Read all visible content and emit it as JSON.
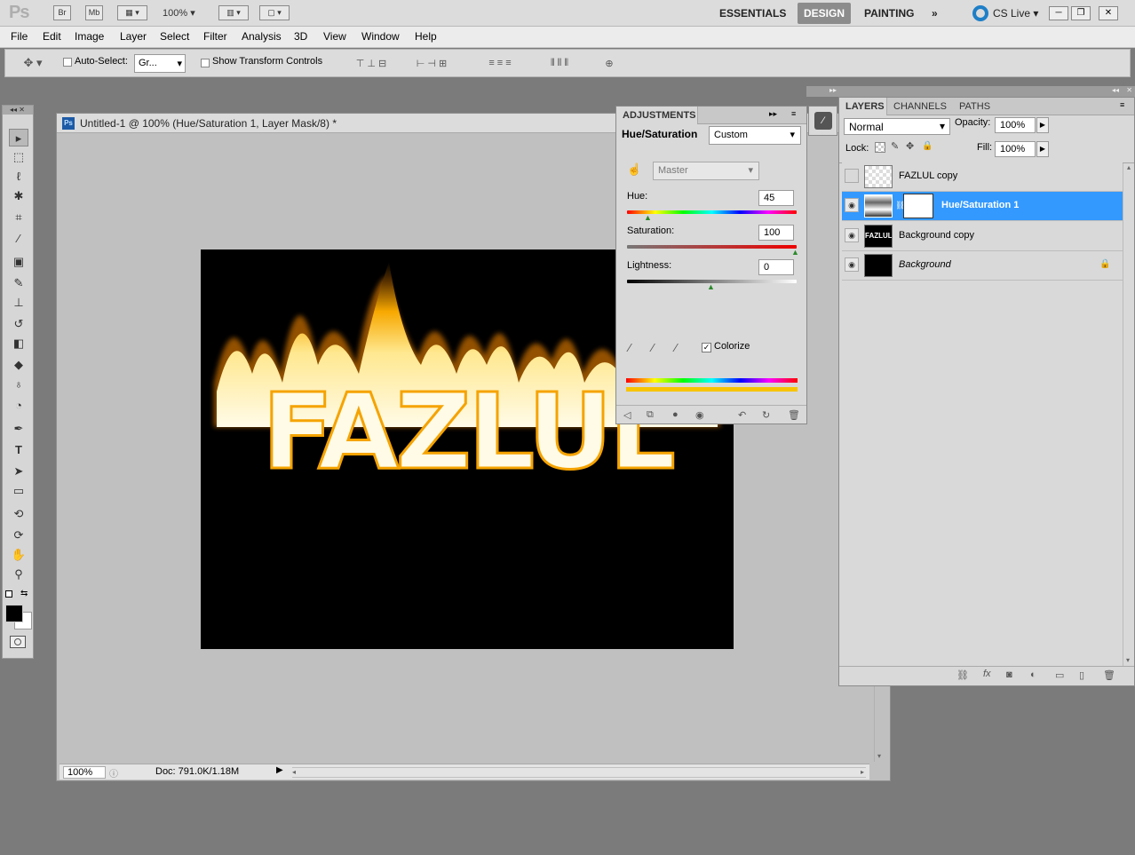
{
  "app": {
    "logo": "Ps",
    "bridge": "Br",
    "minibridge": "Mb",
    "zoom": "100%"
  },
  "workspaces": {
    "essentials": "ESSENTIALS",
    "design": "DESIGN",
    "painting": "PAINTING",
    "more": "»",
    "cslive": "CS Live"
  },
  "menu": [
    "File",
    "Edit",
    "Image",
    "Layer",
    "Select",
    "Filter",
    "Analysis",
    "3D",
    "View",
    "Window",
    "Help"
  ],
  "options": {
    "auto_select_label": "Auto-Select:",
    "auto_select_value": "Gr...",
    "show_transform": "Show Transform Controls"
  },
  "document": {
    "title": "Untitled-1 @ 100% (Hue/Saturation 1, Layer Mask/8) *",
    "zoom": "100%",
    "doc_info": "Doc: 791.0K/1.18M",
    "artwork_text": "FAZLUL"
  },
  "adjustments": {
    "tab": "ADJUSTMENTS",
    "name": "Hue/Saturation",
    "preset": "Custom",
    "channel": "Master",
    "hue_label": "Hue:",
    "hue": "45",
    "sat_label": "Saturation:",
    "sat": "100",
    "light_label": "Lightness:",
    "light": "0",
    "colorize_label": "Colorize",
    "colorize": true
  },
  "layers_panel": {
    "tabs": [
      "LAYERS",
      "CHANNELS",
      "PATHS"
    ],
    "blend": "Normal",
    "opacity_label": "Opacity:",
    "opacity": "100%",
    "lock_label": "Lock:",
    "fill_label": "Fill:",
    "fill": "100%",
    "layers": [
      {
        "name": "FAZLUL  copy",
        "visible": false,
        "selected": false
      },
      {
        "name": "Hue/Saturation 1",
        "visible": true,
        "selected": true
      },
      {
        "name": "Background copy",
        "visible": true,
        "selected": false
      },
      {
        "name": "Background",
        "visible": true,
        "selected": false,
        "locked": true
      }
    ],
    "thumb_text": "FAZLUL"
  }
}
